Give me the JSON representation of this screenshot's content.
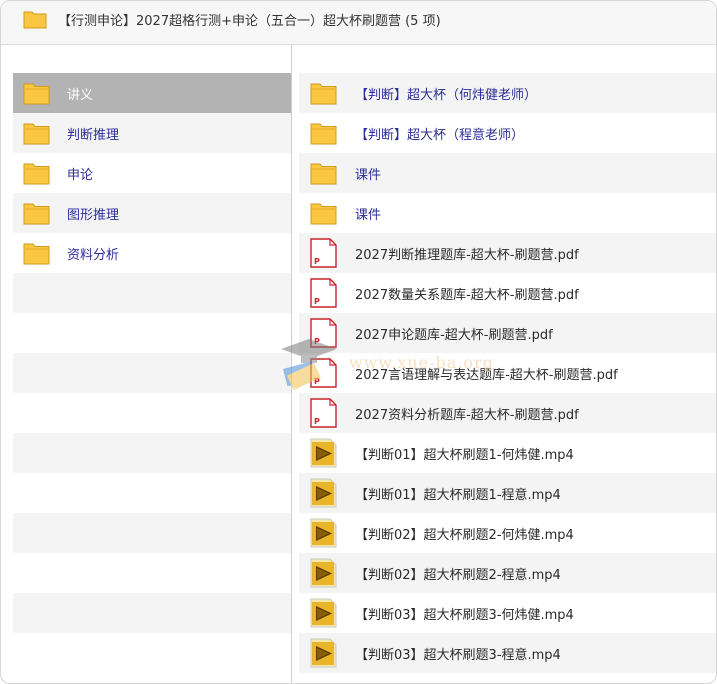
{
  "window": {
    "title": "【行测申论】2027超格行测+申论（五合一）超大杯刷题营 (5 项)"
  },
  "sidebar": {
    "items": [
      {
        "label": "讲义",
        "selected": true
      },
      {
        "label": "判断推理",
        "selected": false
      },
      {
        "label": "申论",
        "selected": false
      },
      {
        "label": "图形推理",
        "selected": false
      },
      {
        "label": "资料分析",
        "selected": false
      }
    ]
  },
  "content": {
    "items": [
      {
        "label": "【判断】超大杯（何炜健老师）",
        "type": "folder"
      },
      {
        "label": "【判断】超大杯（程意老师）",
        "type": "folder"
      },
      {
        "label": "课件",
        "type": "folder"
      },
      {
        "label": "课件",
        "type": "folder"
      },
      {
        "label": "2027判断推理题库-超大杯-刷题营.pdf",
        "type": "pdf"
      },
      {
        "label": "2027数量关系题库-超大杯-刷题营.pdf",
        "type": "pdf"
      },
      {
        "label": "2027申论题库-超大杯-刷题营.pdf",
        "type": "pdf"
      },
      {
        "label": "2027言语理解与表达题库-超大杯-刷题营.pdf",
        "type": "pdf"
      },
      {
        "label": "2027资料分析题库-超大杯-刷题营.pdf",
        "type": "pdf"
      },
      {
        "label": "【判断01】超大杯刷题1-何炜健.mp4",
        "type": "mp4"
      },
      {
        "label": "【判断01】超大杯刷题1-程意.mp4",
        "type": "mp4"
      },
      {
        "label": "【判断02】超大杯刷题2-何炜健.mp4",
        "type": "mp4"
      },
      {
        "label": "【判断02】超大杯刷题2-程意.mp4",
        "type": "mp4"
      },
      {
        "label": "【判断03】超大杯刷题3-何炜健.mp4",
        "type": "mp4"
      },
      {
        "label": "【判断03】超大杯刷题3-程意.mp4",
        "type": "mp4"
      }
    ]
  },
  "watermark": {
    "text": "www.xue-ba.org"
  },
  "colors": {
    "folder_fill": "#f9c741",
    "folder_stroke": "#d19a1c",
    "link_text": "#2d2d9a",
    "selected_row": "#b3b3b3",
    "alt_row": "#f4f4f4",
    "pdf_red": "#c8242b",
    "mp4_yellow": "#e8b52c"
  }
}
